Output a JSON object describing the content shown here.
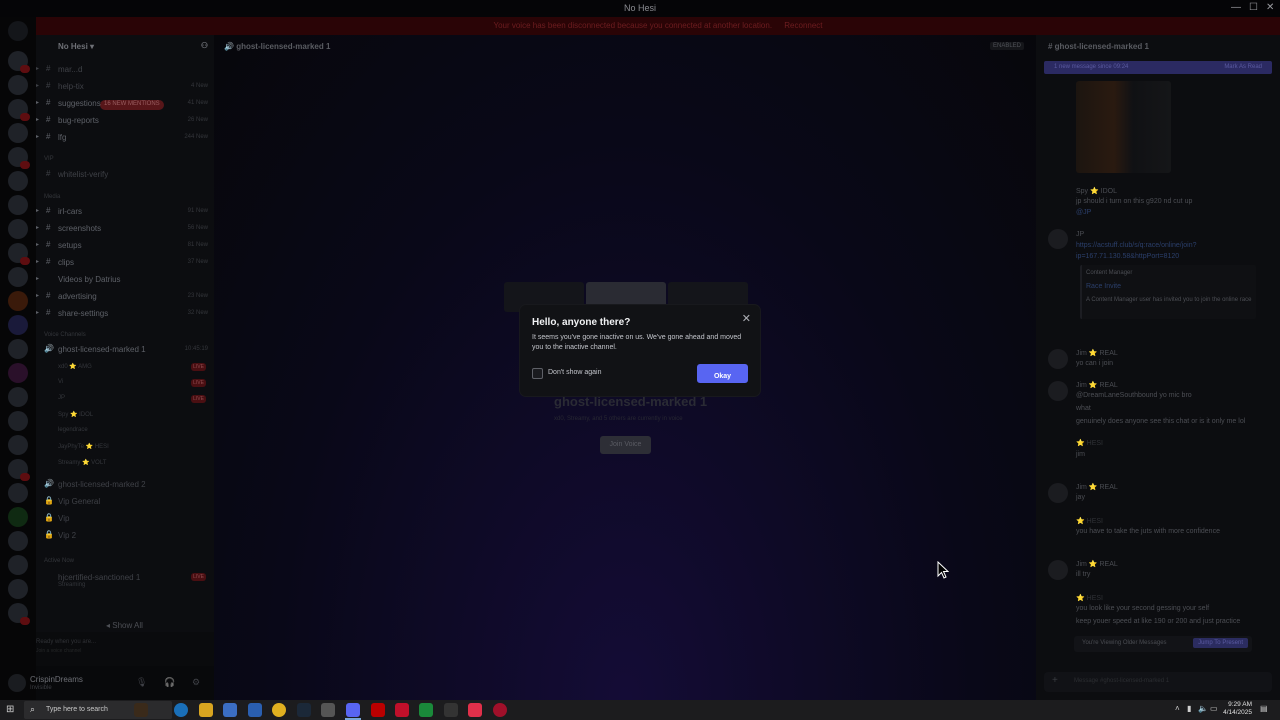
{
  "window": {
    "title": "No Hesi",
    "controls": [
      "—",
      "☐",
      "✕"
    ]
  },
  "notice": {
    "text": "Your voice has been disconnected because you connected at another location.",
    "link": "Reconnect"
  },
  "sidebar": {
    "server_name": "No Hesi",
    "mention_pill": "16 NEW MENTIONS",
    "channels": [
      {
        "glyph": "#",
        "name": "mar...d",
        "count": ""
      },
      {
        "glyph": "#",
        "name": "help-tix",
        "count": "4 New"
      },
      {
        "glyph": "#",
        "name": "suggestions",
        "count": "41 New"
      },
      {
        "glyph": "#",
        "name": "bug-reports",
        "count": "26 New"
      },
      {
        "glyph": "#",
        "name": "lfg",
        "count": "244 New"
      }
    ],
    "category_vip": "VIP",
    "whitelist": "whitelist-verify",
    "category_media": "Media",
    "media_channels": [
      {
        "glyph": "#",
        "name": "irl-cars",
        "count": "91 New"
      },
      {
        "glyph": "#",
        "name": "screenshots",
        "count": "56 New"
      },
      {
        "glyph": "#",
        "name": "setups",
        "count": "81 New"
      },
      {
        "glyph": "#",
        "name": "clips",
        "count": "37 New"
      }
    ],
    "videos_by": "Videos by Datrius",
    "more_channels": [
      {
        "glyph": "#",
        "name": "advertising",
        "count": "23 New"
      },
      {
        "glyph": "#",
        "name": "share-settings",
        "count": "32 New"
      }
    ],
    "category_voice": "Voice Channels",
    "voice_channel": "ghost-licensed-marked 1",
    "voice_time": "10:45:19",
    "voice_users": [
      "xd0 ⭐ AMG",
      "Vi",
      "JP",
      "Spy ⭐ IDOL",
      "legendrace",
      "JayPhyTe ⭐ HESI",
      "Streamy ⭐ VOLT"
    ],
    "live": "LIVE",
    "voice_channel_2": "ghost-licensed-marked 2",
    "vip_general": "Vip General",
    "vip": "Vip",
    "vip2": "Vip 2",
    "category_active": "Active Now",
    "active_item": "hjcertified-sanctioned 1",
    "active_sub": "Streaming",
    "show_all": "Show All",
    "panel_title": "Ready when you are...",
    "panel_sub": "Join a voice channel",
    "user_name": "CrispinDreams",
    "user_status": "Invisible"
  },
  "main": {
    "channel": "ghost-licensed-marked 1",
    "enabled": "ENABLED",
    "vc_title": "ghost-licensed-marked 1",
    "vc_sub": "xd0, Streamy, and 5 others are currently in voice",
    "join_voice": "Join Voice"
  },
  "modal": {
    "title": "Hello, anyone there?",
    "text": "It seems you've gone inactive on us. We've gone ahead and moved you to the inactive channel.",
    "checkbox_label": "Don't show again",
    "ok_label": "Okay",
    "close": "✕"
  },
  "chat": {
    "header": "ghost-licensed-marked 1",
    "new_messages": "1 new message since 09:24",
    "mark_read": "Mark As Read",
    "messages": [
      {
        "text": "Spy ⭐ IDOL"
      },
      {
        "text": "jp should i turn on this g920 nd cut up"
      },
      {
        "text": "@JP"
      },
      {
        "text": "JP"
      },
      {
        "text": "https://acstuff.club/s/q:race/online/join?"
      },
      {
        "text": "ip=167.71.130.58&httpPort=8120"
      },
      {
        "text": "Content Manager"
      },
      {
        "text": "Race Invite"
      },
      {
        "text": "A Content Manager user has invited you to join the online race"
      },
      {
        "text": "Jim ⭐ REAL"
      },
      {
        "text": "yo can i join"
      },
      {
        "text": "Jim ⭐ REAL"
      },
      {
        "text": "@DreamLaneSouthbound yo mic bro"
      },
      {
        "text": "what"
      },
      {
        "text": "genuinely does anyone see this chat or is it only me lol"
      },
      {
        "text": "⭐ HESI"
      },
      {
        "text": "jim"
      },
      {
        "text": "Jim ⭐ REAL"
      },
      {
        "text": "jay"
      },
      {
        "text": "⭐ HESI"
      },
      {
        "text": "you have to take the juts with more confidence"
      },
      {
        "text": "Jim ⭐ REAL"
      },
      {
        "text": "ill try"
      },
      {
        "text": "⭐ HESI"
      },
      {
        "text": "you look like your second gessing your self"
      },
      {
        "text": "keep youer speed at like 190 or 200 and just practice"
      }
    ],
    "older_label": "You're Viewing Older Messages",
    "jump_label": "Jump To Present",
    "input_placeholder": "Message #ghost-licensed-marked 1"
  },
  "taskbar": {
    "search_placeholder": "Type here to search",
    "time": "9:29 AM",
    "date": "4/14/2025"
  }
}
